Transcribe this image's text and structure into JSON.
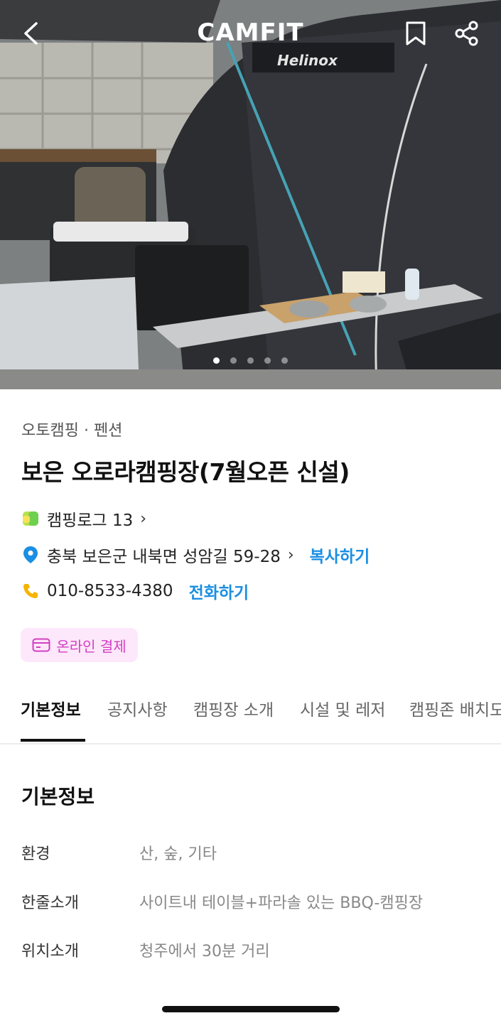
{
  "header": {
    "logo": "CAMFIT",
    "back_icon": "chevron-left-icon",
    "bookmark_icon": "bookmark-icon",
    "share_icon": "share-icon"
  },
  "hero": {
    "image_description": "tent campsite photo",
    "carousel_total": 5,
    "carousel_active": 1
  },
  "camp": {
    "category": "오토캠핑 · 펜션",
    "name": "보은 오로라캠핑장(7월오픈 신설)",
    "camping_log": "캠핑로그 13",
    "address": "충북 보은군 내북면 성암길 59-28",
    "copy_label": "복사하기",
    "phone": "010-8533-4380",
    "call_label": "전화하기",
    "payment_badge": "온라인 결제"
  },
  "tabs": [
    {
      "label": "기본정보",
      "active": true
    },
    {
      "label": "공지사항",
      "active": false
    },
    {
      "label": "캠핑장 소개",
      "active": false
    },
    {
      "label": "시설 및 레저",
      "active": false
    },
    {
      "label": "캠핑존 배치도",
      "active": false
    }
  ],
  "basic_info": {
    "title": "기본정보",
    "rows": [
      {
        "key": "환경",
        "value": "산, 숲, 기타"
      },
      {
        "key": "한줄소개",
        "value": "사이트내 테이블+파라솔 있는 BBQ-캠핑장"
      },
      {
        "key": "위치소개",
        "value": "청주에서 30분 거리"
      }
    ]
  },
  "colors": {
    "link": "#1a8fe3",
    "badge_bg": "#fde8fb",
    "badge_text": "#d23fc3",
    "location_pin": "#1a8fe3",
    "phone_icon": "#f5b400"
  }
}
